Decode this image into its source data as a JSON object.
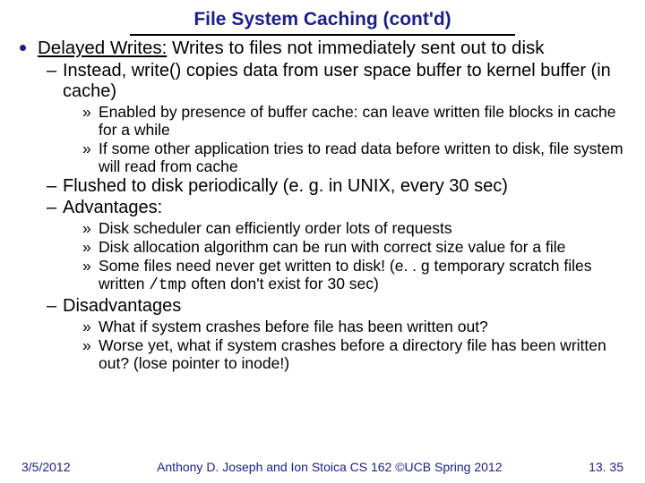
{
  "title": "File System Caching (cont'd)",
  "bullet": {
    "lead": "Delayed Writes:",
    "rest": " Writes to files not immediately sent out to disk"
  },
  "d1": "Instead, write() copies data from user space buffer to kernel buffer (in cache)",
  "d1c1": "Enabled by presence of buffer cache: can leave written file blocks in cache for a while",
  "d1c2": "If some other application tries to read data before written to disk, file system will read from cache",
  "d2": "Flushed to disk periodically (e. g. in UNIX, every 30 sec)",
  "d3": "Advantages:",
  "d3c1": "Disk scheduler can efficiently order lots of requests",
  "d3c2": "Disk allocation algorithm can be run with correct size value for a file",
  "d3c3a": "Some files need never get written to disk! (e. . g temporary scratch files written ",
  "d3c3_mono": "/tmp",
  "d3c3b": " often don't exist for 30 sec)",
  "d4": "Disadvantages",
  "d4c1": "What if system crashes before file has been written out?",
  "d4c2": "Worse yet, what if system crashes before a directory file has been written out? (lose pointer to inode!)",
  "footer": {
    "date": "3/5/2012",
    "center": "Anthony D. Joseph and Ion Stoica CS 162 ©UCB Spring 2012",
    "page": "13. 35"
  }
}
